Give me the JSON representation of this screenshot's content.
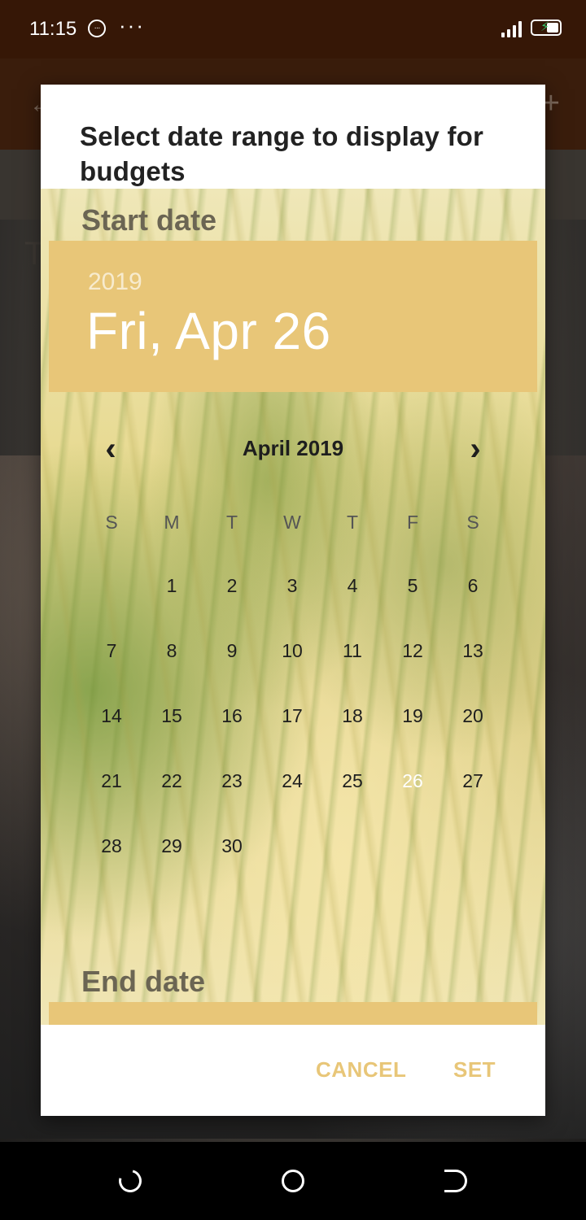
{
  "status_bar": {
    "time": "11:15",
    "more": "···"
  },
  "background_app": {
    "back_glyph": "←",
    "add_glyph": "+",
    "title_fragment": "T"
  },
  "dialog": {
    "title": "Select date range to display for budgets",
    "start_section_label": "Start date",
    "end_section_label": "End date",
    "header": {
      "year": "2019",
      "date": "Fri, Apr 26"
    },
    "calendar": {
      "month_label": "April 2019",
      "prev_glyph": "‹",
      "next_glyph": "›",
      "weekdays": [
        "S",
        "M",
        "T",
        "W",
        "T",
        "F",
        "S"
      ],
      "weeks": [
        [
          "",
          "1",
          "2",
          "3",
          "4",
          "5",
          "6"
        ],
        [
          "7",
          "8",
          "9",
          "10",
          "11",
          "12",
          "13"
        ],
        [
          "14",
          "15",
          "16",
          "17",
          "18",
          "19",
          "20"
        ],
        [
          "21",
          "22",
          "23",
          "24",
          "25",
          "26",
          "27"
        ],
        [
          "28",
          "29",
          "30",
          "",
          "",
          "",
          ""
        ]
      ],
      "selected_day": "26"
    },
    "actions": {
      "cancel_label": "CANCEL",
      "set_label": "SET"
    }
  },
  "colors": {
    "accent": "#e8c678",
    "status_bar": "#361706",
    "toolbar": "#3a1d0c"
  }
}
